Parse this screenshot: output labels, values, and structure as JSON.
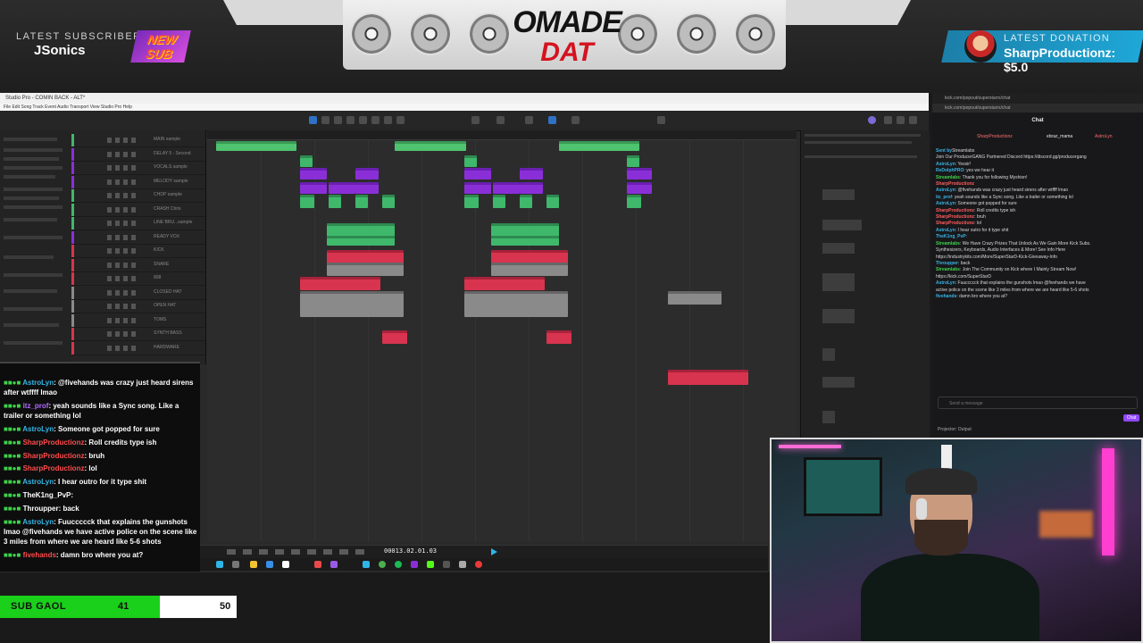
{
  "overlay": {
    "latest_subscriber_label": "LATEST SUBSCRIBER",
    "latest_subscriber_name": "JSonics",
    "new_sub_badge": "NEW SUB",
    "latest_donation_label": "LATEST DONATION",
    "latest_donation_value": "SharpProductionz: $5.0",
    "logo_line1": "OMADE",
    "logo_line2": "DAT"
  },
  "daw": {
    "title": "Studio Pro - COMIN BACK - ALT*",
    "menu": "File  Edit  Song  Track  Event  Audio  Transport  View  Studio Pro  Help",
    "timecode": "00013.02.01.03",
    "tracks": [
      {
        "name": "MAIN sample",
        "color": "#3fb86b"
      },
      {
        "name": "DELAY 5 - Second",
        "color": "#8a2fd8"
      },
      {
        "name": "VOCALS sample",
        "color": "#8a2fd8"
      },
      {
        "name": "MELODY sample",
        "color": "#8a2fd8"
      },
      {
        "name": "CHOP sample",
        "color": "#3fb86b"
      },
      {
        "name": "CRASH Chris",
        "color": "#3fb86b"
      },
      {
        "name": "LINE BRU...sample",
        "color": "#3fb86b"
      },
      {
        "name": "READY VOX",
        "color": "#8a2fd8"
      },
      {
        "name": "KICK",
        "color": "#d8344f"
      },
      {
        "name": "SNARE",
        "color": "#d8344f"
      },
      {
        "name": "808",
        "color": "#d8344f"
      },
      {
        "name": "CLOSED HAT",
        "color": "#8a8a8a"
      },
      {
        "name": "OPEN HAT",
        "color": "#8a8a8a"
      },
      {
        "name": "TOMS",
        "color": "#8a8a8a"
      },
      {
        "name": "SYNTH BASS",
        "color": "#d8344f"
      },
      {
        "name": "HARDWARE",
        "color": "#d8344f"
      }
    ]
  },
  "chat": {
    "browser_url": "kick.com/popout/superstarrx/chat",
    "title": "Chat",
    "tabs": [
      "SharpProductionz",
      "ebraz_mama",
      "AstroLyn"
    ],
    "input_placeholder": "Send a message",
    "send_button": "Chat",
    "projector_label": "Projector: Output",
    "messages": [
      {
        "user": "Sent by",
        "text": "Streamlabs"
      },
      {
        "user": "",
        "text": "Join Our ProducerGANG Partnered Discord https://discord.gg/producergang"
      },
      {
        "user": "AstroLyn",
        "text": ": Yessir!"
      },
      {
        "user": "ReDolphPRO",
        "text": ": yes we hear it"
      },
      {
        "user": "Streamlabs",
        "text": ": Thank you for following Myshion!"
      },
      {
        "user": "SharpProductionz",
        "text": ""
      },
      {
        "user": "AstroLyn",
        "text": ": @fivehands was crazy just heard sirens after wtffff lmao"
      },
      {
        "user": "itz_prof",
        "text": ": yeah sounds like a Sync song. Like a trailer or something lol"
      },
      {
        "user": "AstroLyn",
        "text": ": Someone got popped for sure"
      },
      {
        "user": "SharpProductionz",
        "text": ": Roll credits type ish"
      },
      {
        "user": "SharpProductionz",
        "text": ": bruh"
      },
      {
        "user": "SharpProductionz",
        "text": ": lol"
      },
      {
        "user": "AstroLyn",
        "text": ": I hear outro for it type shit"
      },
      {
        "user": "TheK1ng_PvP",
        "text": ":"
      },
      {
        "user": "Streamlabs",
        "text": ": We Have Crazy Prizes That Unlock As We Gain More Kick Subs."
      },
      {
        "user": "",
        "text": "Synthesizers, Keyboards, Audio Interfaces & More! See Info Here"
      },
      {
        "user": "",
        "text": "https://industrykits.com/More/SuperStarD-Kick-Giveaway-Info"
      },
      {
        "user": "Throupper",
        "text": ": back"
      },
      {
        "user": "Streamlabs",
        "text": ": Join The Community on Kick where I Mainly Stream Now!"
      },
      {
        "user": "",
        "text": "https://kick.com/SuperStarD"
      },
      {
        "user": "AstroLyn",
        "text": ": Fuuccccck that explains the gunshots lmao @fivehands we have"
      },
      {
        "user": "",
        "text": "active police on the scene like 3 miles from where we are heard like 5-6 shots"
      },
      {
        "user": "fivehands",
        "text": ": damn bro where you at?"
      }
    ]
  },
  "overlay_chat": [
    {
      "user": "AstroLyn",
      "style": "user",
      "text": ": @fivehands was crazy just heard sirens after wtffff lmao"
    },
    {
      "user": "itz_prof",
      "style": "user-itz",
      "text": ": yeah sounds like a Sync song. Like a trailer or something lol"
    },
    {
      "user": "AstroLyn",
      "style": "user",
      "text": ": Someone got popped for sure"
    },
    {
      "user": "SharpProductionz",
      "style": "user-prod",
      "text": ": Roll credits type ish"
    },
    {
      "user": "SharpProductionz",
      "style": "user-prod",
      "text": ": bruh"
    },
    {
      "user": "SharpProductionz",
      "style": "user-prod",
      "text": ": lol"
    },
    {
      "user": "AstroLyn",
      "style": "user",
      "text": ": I hear outro for it type shit"
    },
    {
      "user": "TheK1ng_PvP",
      "style": "user-plain",
      "text": ":"
    },
    {
      "user": "Throupper",
      "style": "user-plain",
      "text": ": back"
    },
    {
      "user": "AstroLyn",
      "style": "user",
      "text": ": Fuuccccck that explains the gunshots lmao @fivehands we have active police on the scene like 3 miles from where we are heard like 5-6 shots"
    },
    {
      "user": "fivehands",
      "style": "user-prod",
      "text": ": damn bro where you at?"
    }
  ],
  "sub_goal": {
    "label": "SUB GAOL",
    "current": 41,
    "target": 50
  },
  "colors": {
    "goal_fill": "#1ad01a",
    "accent_blue": "#2f72c4",
    "kick_purple": "#9147ff"
  }
}
